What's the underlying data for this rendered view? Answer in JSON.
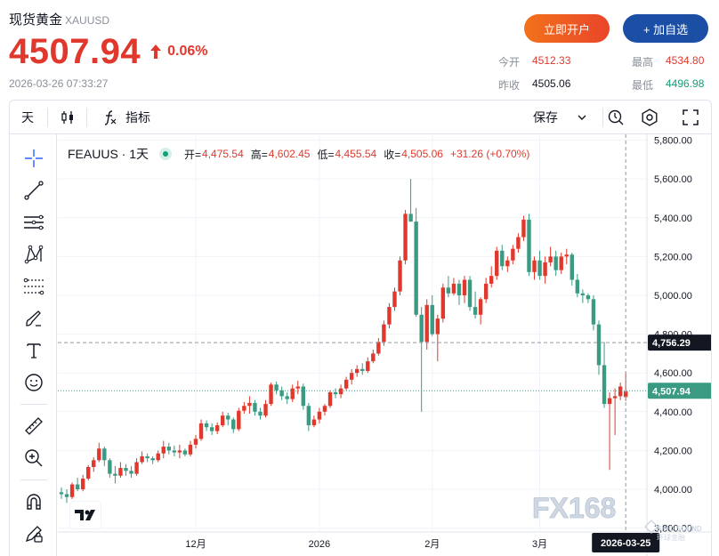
{
  "header": {
    "title": "现货黄金",
    "symbol": "XAUUSD",
    "price": "4507.94",
    "change_pct": "0.06%",
    "datetime": "2026-03-26 07:33:27",
    "open_account_label": "立即开户",
    "add_watch_label": "+ 加自选"
  },
  "stats": {
    "open_label": "今开",
    "open_value": "4512.33",
    "high_label": "最高",
    "high_value": "4534.80",
    "prev_label": "昨收",
    "prev_value": "4505.06",
    "low_label": "最低",
    "low_value": "4496.98"
  },
  "toolbar": {
    "interval": "天",
    "indicators": "指标",
    "save": "保存"
  },
  "legend": {
    "symbol": "FEAUUS · 1天",
    "open_label": "开=",
    "open_value": "4,475.54",
    "high_label": "高=",
    "high_value": "4,602.45",
    "low_label": "低=",
    "low_value": "4,455.54",
    "close_label": "收=",
    "close_value": "4,505.06",
    "change": "+31.26 (+0.70%)"
  },
  "tools": [
    "crosshair-icon",
    "trend-line-icon",
    "horizontal-lines-icon",
    "pattern-icon",
    "fib-icon",
    "brush-icon",
    "text-icon",
    "emoji-icon",
    "ruler-icon",
    "zoom-in-icon",
    "magnet-icon",
    "lock-pencil-icon"
  ],
  "colors": {
    "up": "#e0382c",
    "down": "#3a9b82",
    "accent": "#1b4fa6"
  },
  "chart_data": {
    "type": "candlestick",
    "y_ticks": [
      "3,800.00",
      "4,000.00",
      "4,200.00",
      "4,400.00",
      "4,600.00",
      "4,800.00",
      "5,000.00",
      "5,200.00",
      "5,400.00",
      "5,600.00",
      "5,800.00"
    ],
    "y_tick_values": [
      3800,
      4000,
      4200,
      4400,
      4600,
      4800,
      5000,
      5200,
      5400,
      5600,
      5800
    ],
    "ylim": [
      3780,
      5830
    ],
    "x_ticks": [
      {
        "label": "12月",
        "index": 25
      },
      {
        "label": "2026",
        "index": 48
      },
      {
        "label": "2月",
        "index": 69
      },
      {
        "label": "3月",
        "index": 89
      }
    ],
    "price_tags": [
      {
        "label": "4,756.29",
        "value": 4756.29,
        "style": "dark",
        "line": "dashed"
      },
      {
        "label": "4,507.94",
        "value": 4507.94,
        "style": "teal",
        "line": "dotted"
      }
    ],
    "crosshair_label": "2026-03-25",
    "crosshair_index": 105,
    "candles": [
      [
        3985,
        4010,
        3950,
        3975
      ],
      [
        3975,
        4000,
        3930,
        3960
      ],
      [
        3960,
        4035,
        3950,
        4025
      ],
      [
        4025,
        4060,
        3990,
        4000
      ],
      [
        4000,
        4075,
        3990,
        4055
      ],
      [
        4055,
        4125,
        4045,
        4115
      ],
      [
        4115,
        4165,
        4090,
        4150
      ],
      [
        4150,
        4240,
        4140,
        4210
      ],
      [
        4210,
        4220,
        4120,
        4150
      ],
      [
        4150,
        4160,
        4060,
        4080
      ],
      [
        4080,
        4120,
        4030,
        4070
      ],
      [
        4070,
        4140,
        4060,
        4110
      ],
      [
        4110,
        4130,
        4070,
        4095
      ],
      [
        4095,
        4120,
        4060,
        4080
      ],
      [
        4080,
        4160,
        4070,
        4140
      ],
      [
        4140,
        4195,
        4130,
        4170
      ],
      [
        4170,
        4185,
        4140,
        4160
      ],
      [
        4160,
        4170,
        4130,
        4150
      ],
      [
        4150,
        4200,
        4140,
        4185
      ],
      [
        4185,
        4250,
        4160,
        4220
      ],
      [
        4220,
        4240,
        4180,
        4200
      ],
      [
        4200,
        4225,
        4170,
        4190
      ],
      [
        4190,
        4230,
        4160,
        4200
      ],
      [
        4200,
        4210,
        4170,
        4180
      ],
      [
        4180,
        4250,
        4170,
        4230
      ],
      [
        4230,
        4280,
        4210,
        4260
      ],
      [
        4260,
        4360,
        4250,
        4340
      ],
      [
        4340,
        4355,
        4300,
        4320
      ],
      [
        4320,
        4340,
        4280,
        4300
      ],
      [
        4300,
        4345,
        4285,
        4330
      ],
      [
        4330,
        4400,
        4320,
        4380
      ],
      [
        4380,
        4395,
        4330,
        4360
      ],
      [
        4360,
        4370,
        4290,
        4310
      ],
      [
        4310,
        4420,
        4300,
        4405
      ],
      [
        4405,
        4450,
        4390,
        4430
      ],
      [
        4430,
        4480,
        4390,
        4445
      ],
      [
        4445,
        4460,
        4380,
        4400
      ],
      [
        4400,
        4420,
        4360,
        4380
      ],
      [
        4380,
        4460,
        4370,
        4440
      ],
      [
        4440,
        4550,
        4430,
        4540
      ],
      [
        4540,
        4555,
        4490,
        4510
      ],
      [
        4510,
        4530,
        4460,
        4480
      ],
      [
        4480,
        4500,
        4440,
        4465
      ],
      [
        4465,
        4540,
        4450,
        4520
      ],
      [
        4520,
        4560,
        4490,
        4530
      ],
      [
        4530,
        4545,
        4410,
        4430
      ],
      [
        4430,
        4445,
        4300,
        4330
      ],
      [
        4330,
        4380,
        4320,
        4360
      ],
      [
        4360,
        4420,
        4340,
        4400
      ],
      [
        4400,
        4440,
        4380,
        4430
      ],
      [
        4430,
        4510,
        4420,
        4500
      ],
      [
        4500,
        4520,
        4470,
        4490
      ],
      [
        4490,
        4540,
        4470,
        4520
      ],
      [
        4520,
        4580,
        4510,
        4565
      ],
      [
        4565,
        4620,
        4540,
        4600
      ],
      [
        4600,
        4640,
        4580,
        4620
      ],
      [
        4620,
        4650,
        4590,
        4610
      ],
      [
        4610,
        4680,
        4600,
        4660
      ],
      [
        4660,
        4720,
        4650,
        4700
      ],
      [
        4700,
        4780,
        4690,
        4760
      ],
      [
        4760,
        4870,
        4740,
        4850
      ],
      [
        4850,
        4960,
        4830,
        4940
      ],
      [
        4940,
        5040,
        4920,
        5020
      ],
      [
        5020,
        5200,
        5000,
        5180
      ],
      [
        5180,
        5440,
        5160,
        5420
      ],
      [
        5420,
        5600,
        5380,
        5380
      ],
      [
        5380,
        5450,
        4890,
        4900
      ],
      [
        4900,
        4940,
        4400,
        4760
      ],
      [
        4760,
        4980,
        4720,
        4950
      ],
      [
        4950,
        5000,
        4790,
        4800
      ],
      [
        4800,
        4900,
        4660,
        4880
      ],
      [
        4880,
        5060,
        4860,
        5040
      ],
      [
        5040,
        5100,
        4990,
        5010
      ],
      [
        5010,
        5090,
        5000,
        5060
      ],
      [
        5060,
        5080,
        4950,
        5000
      ],
      [
        5000,
        5100,
        4960,
        5080
      ],
      [
        5080,
        5100,
        4920,
        4940
      ],
      [
        4940,
        5020,
        4880,
        4900
      ],
      [
        4900,
        4990,
        4850,
        4980
      ],
      [
        4980,
        5090,
        4960,
        5060
      ],
      [
        5060,
        5150,
        5040,
        5100
      ],
      [
        5100,
        5250,
        5080,
        5230
      ],
      [
        5230,
        5260,
        5130,
        5150
      ],
      [
        5150,
        5200,
        5120,
        5180
      ],
      [
        5180,
        5260,
        5160,
        5240
      ],
      [
        5240,
        5320,
        5220,
        5300
      ],
      [
        5300,
        5410,
        5280,
        5390
      ],
      [
        5390,
        5420,
        5100,
        5120
      ],
      [
        5120,
        5200,
        5080,
        5180
      ],
      [
        5180,
        5230,
        5080,
        5100
      ],
      [
        5100,
        5200,
        5060,
        5170
      ],
      [
        5170,
        5250,
        5150,
        5200
      ],
      [
        5200,
        5230,
        5100,
        5130
      ],
      [
        5130,
        5220,
        5110,
        5200
      ],
      [
        5200,
        5240,
        5160,
        5210
      ],
      [
        5210,
        5220,
        5050,
        5080
      ],
      [
        5080,
        5110,
        4990,
        5010
      ],
      [
        5010,
        5030,
        4960,
        5000
      ],
      [
        5000,
        5010,
        4960,
        4980
      ],
      [
        4980,
        5000,
        4820,
        4850
      ],
      [
        4850,
        4870,
        4590,
        4640
      ],
      [
        4640,
        4760,
        4420,
        4440
      ],
      [
        4440,
        4500,
        4100,
        4470
      ],
      [
        4470,
        4520,
        4280,
        4480
      ],
      [
        4480,
        4550,
        4460,
        4530
      ],
      [
        4475.54,
        4602.45,
        4455.54,
        4505.06
      ]
    ]
  },
  "watermark": {
    "brand": "FX168",
    "sub_line1": "SINO SOUND",
    "sub_line2": "环球金融"
  }
}
